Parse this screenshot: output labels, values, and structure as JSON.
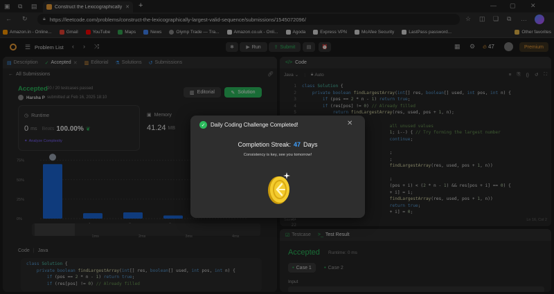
{
  "browser": {
    "tab_title": "Construct the Lexicographically L",
    "new_tab_symbol": "+",
    "url": "https://leetcode.com/problems/construct-the-lexicographically-largest-valid-sequence/submissions/1545072096/",
    "bookmarks": [
      {
        "label": "Amazon.in - Online...",
        "color": "#f90"
      },
      {
        "label": "Gmail",
        "color": "#ea4335"
      },
      {
        "label": "YouTube",
        "color": "#ff0000"
      },
      {
        "label": "Maps",
        "color": "#34a853"
      },
      {
        "label": "News",
        "color": "#4285f4"
      },
      {
        "label": "Olymp Trade — Tra...",
        "color": "#888"
      },
      {
        "label": "Amazon.co.uk - Onli...",
        "color": "#ddd"
      },
      {
        "label": "Agoda",
        "color": "#ddd"
      },
      {
        "label": "Express VPN",
        "color": "#ddd"
      },
      {
        "label": "McAfee Security",
        "color": "#ddd"
      },
      {
        "label": "LastPass password...",
        "color": "#ddd"
      }
    ],
    "other_favorites": "Other favorites"
  },
  "nav": {
    "problem_list": "Problem List",
    "run": "Run",
    "submit": "Submit",
    "streak_count": "47",
    "premium": "Premium"
  },
  "left": {
    "tabs": [
      "Description",
      "Accepted",
      "Editorial",
      "Solutions",
      "Submissions"
    ],
    "all_submissions": "All Submissions",
    "status": "Accepted",
    "testcases": "20 / 20 testcases passed",
    "user": "Harsha P",
    "submitted": "submitted at Feb 16, 2025 18:10",
    "editorial_btn": "Editorial",
    "solution_btn": "Solution",
    "runtime_label": "Runtime",
    "runtime_value": "0",
    "runtime_unit": "ms",
    "beats_label": "Beats",
    "beats_value": "100.00%",
    "analyze": "Analyze Complexity",
    "memory_label": "Memory",
    "memory_value": "41.24",
    "memory_unit": "MB",
    "y_ticks": [
      "75%",
      "50%",
      "25%",
      "0%"
    ],
    "x_ticks": [
      "1ms",
      "2ms",
      "3ms"
    ],
    "x_ticks2": [
      "1ms",
      "2ms",
      "3ms",
      "4ms"
    ],
    "code_label": "Code",
    "code_lang": "Java"
  },
  "chart_data": {
    "type": "bar",
    "categories": [
      "0ms",
      "1ms",
      "2ms",
      "3ms"
    ],
    "values": [
      70,
      7,
      8,
      4
    ],
    "ylim": [
      0,
      80
    ],
    "y_ticks": [
      "75%",
      "50%",
      "25%",
      "0%"
    ],
    "xlabel": "",
    "ylabel": ""
  },
  "editor": {
    "title": "Code",
    "lang": "Java",
    "auto": "Auto",
    "saved": "Saved",
    "position": "Ln 16, Col 2",
    "lines": [
      "1",
      "2",
      "3",
      "4",
      "5",
      "6",
      "7",
      "8",
      "9",
      "10",
      "11",
      "12",
      "13",
      "14",
      "15",
      "16",
      "17",
      "18",
      "19",
      "20",
      "21",
      "22"
    ]
  },
  "test": {
    "testcase_tab": "Testcase",
    "result_tab": "Test Result",
    "accepted": "Accepted",
    "runtime": "Runtime: 0 ms",
    "case1": "Case 1",
    "case2": "Case 2",
    "input": "Input"
  },
  "modal": {
    "title": "Daily Coding Challenge Completed!",
    "streak_prefix": "Completion Streak:",
    "streak_num": "47",
    "streak_suffix": "Days",
    "subtitle": "Consistency is key, see you tomorrow!",
    "close": "✕",
    "accent": "#2cbb5d",
    "blue": "#3fa0ff"
  }
}
